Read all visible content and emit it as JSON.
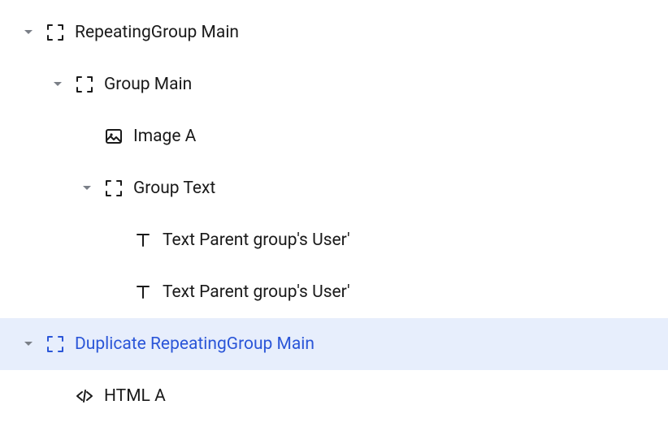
{
  "tree": [
    {
      "id": "repeating-group-main",
      "label": "RepeatingGroup Main",
      "indent": 0,
      "hasChildren": true,
      "expanded": true,
      "icon": "group",
      "selected": false
    },
    {
      "id": "group-main",
      "label": "Group Main",
      "indent": 1,
      "hasChildren": true,
      "expanded": true,
      "icon": "group",
      "selected": false
    },
    {
      "id": "image-a",
      "label": "Image A",
      "indent": 2,
      "hasChildren": false,
      "expanded": false,
      "icon": "image",
      "selected": false
    },
    {
      "id": "group-text",
      "label": "Group Text",
      "indent": 2,
      "hasChildren": true,
      "expanded": true,
      "icon": "group",
      "selected": false
    },
    {
      "id": "text-user-1",
      "label": "Text Parent group's User'",
      "indent": 3,
      "hasChildren": false,
      "expanded": false,
      "icon": "text",
      "selected": false
    },
    {
      "id": "text-user-2",
      "label": "Text Parent group's User'",
      "indent": 3,
      "hasChildren": false,
      "expanded": false,
      "icon": "text",
      "selected": false
    },
    {
      "id": "duplicate-repeating-group-main",
      "label": "Duplicate RepeatingGroup Main",
      "indent": 0,
      "hasChildren": true,
      "expanded": true,
      "icon": "group",
      "selected": true
    },
    {
      "id": "html-a",
      "label": "HTML A",
      "indent": 1,
      "hasChildren": false,
      "expanded": false,
      "icon": "html",
      "selected": false
    }
  ]
}
